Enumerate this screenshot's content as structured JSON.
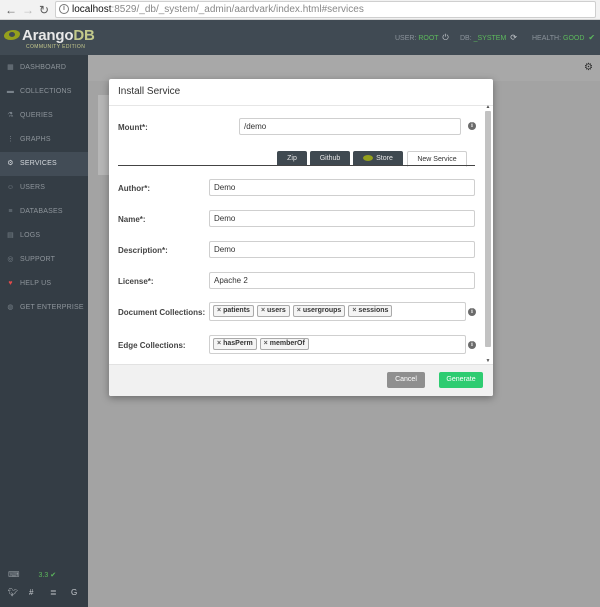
{
  "browser": {
    "back_icon": "arrow-left-icon",
    "forward_icon": "arrow-right-icon",
    "reload_icon": "reload-icon",
    "url_host": "localhost",
    "url_rest": ":8529/_db/_system/_admin/aardvark/index.html#services"
  },
  "header": {
    "brand_main": "Arango",
    "brand_suffix": "DB",
    "edition": "COMMUNITY EDITION",
    "user_label": "USER:",
    "user_value": "ROOT",
    "db_label": "DB:",
    "db_value": "_SYSTEM",
    "health_label": "HEALTH:",
    "health_value": "GOOD",
    "accent": "#94a01d",
    "good_color": "#5cb85c"
  },
  "sidebar": {
    "items": [
      {
        "label": "DASHBOARD",
        "icon": "dashboard-icon",
        "glyph": "▦"
      },
      {
        "label": "COLLECTIONS",
        "icon": "folder-icon",
        "glyph": "▬"
      },
      {
        "label": "QUERIES",
        "icon": "flask-icon",
        "glyph": "⚗"
      },
      {
        "label": "GRAPHS",
        "icon": "graph-icon",
        "glyph": "⋮"
      },
      {
        "label": "SERVICES",
        "icon": "cogs-icon",
        "glyph": "⚙"
      },
      {
        "label": "USERS",
        "icon": "users-icon",
        "glyph": "☺"
      },
      {
        "label": "DATABASES",
        "icon": "database-icon",
        "glyph": "≡"
      },
      {
        "label": "LOGS",
        "icon": "file-icon",
        "glyph": "▤"
      },
      {
        "label": "SUPPORT",
        "icon": "life-ring-icon",
        "glyph": "◎"
      },
      {
        "label": "HELP US",
        "icon": "heart-icon",
        "glyph": "♥"
      },
      {
        "label": "GET ENTERPRISE",
        "icon": "globe-icon",
        "glyph": "◍"
      }
    ],
    "active": "SERVICES",
    "version": "3.3",
    "social": [
      "twitter-icon",
      "slack-icon",
      "stackoverflow-icon",
      "google-icon"
    ]
  },
  "modal": {
    "title": "Install Service",
    "mount_label": "Mount*:",
    "mount_value": "/demo",
    "tabs": [
      {
        "label": "Zip"
      },
      {
        "label": "Github"
      },
      {
        "label": "Store"
      },
      {
        "label": "New Service"
      }
    ],
    "active_tab": "New Service",
    "author_label": "Author*:",
    "author_value": "Demo",
    "name_label": "Name*:",
    "name_value": "Demo",
    "description_label": "Description*:",
    "description_value": "Demo",
    "license_label": "License*:",
    "license_value": "Apache 2",
    "doc_collections_label": "Document Collections:",
    "doc_collections": [
      "patients",
      "users",
      "usergroups",
      "sessions"
    ],
    "edge_collections_label": "Edge Collections:",
    "edge_collections": [
      "hasPerm",
      "memberOf"
    ],
    "cancel_label": "Cancel",
    "generate_label": "Generate",
    "generate_color": "#2ecc71"
  }
}
